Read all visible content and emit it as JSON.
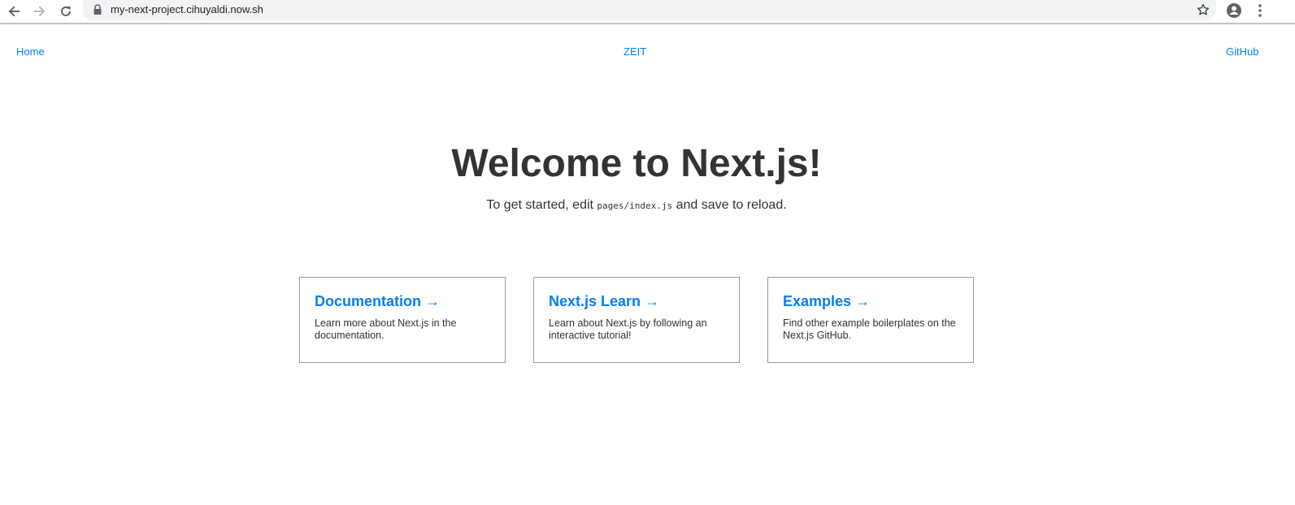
{
  "browser": {
    "url": "my-next-project.cihuyaldi.now.sh",
    "icons": {
      "back": "arrow-left-icon",
      "forward": "arrow-right-icon",
      "reload": "reload-icon",
      "lock": "lock-icon",
      "bookmark": "star-icon",
      "account": "account-circle-icon",
      "menu": "more-vert-icon"
    }
  },
  "nav": {
    "home": "Home",
    "zeit": "ZEIT",
    "github": "GitHub"
  },
  "hero": {
    "title": "Welcome to Next.js!",
    "desc_before": "To get started, edit ",
    "desc_code": "pages/index.js",
    "desc_after": " and save to reload."
  },
  "cards": [
    {
      "title": "Documentation →",
      "description": "Learn more about Next.js in the documentation."
    },
    {
      "title": "Next.js Learn →",
      "description": "Learn about Next.js by following an interactive tutorial!"
    },
    {
      "title": "Examples →",
      "description": "Find other example boilerplates on the Next.js GitHub."
    }
  ],
  "colors": {
    "link": "#067df7",
    "text": "#333333",
    "card_border": "#9b9b9b"
  }
}
